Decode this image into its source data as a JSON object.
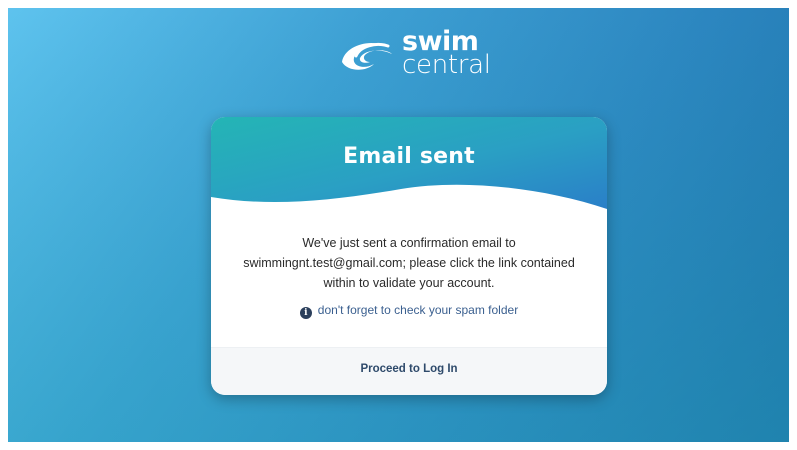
{
  "brand": {
    "name_line1": "swim",
    "name_line2": "central",
    "logo_icon": "swirl-icon"
  },
  "card": {
    "title": "Email sent",
    "message_lines": [
      "We've just sent a confirmation email to",
      "swimmingnt.test@gmail.com; please click the link contained",
      "within to validate your account."
    ],
    "hint_icon": "info-circle-icon",
    "hint_text": "don't forget to check your spam folder",
    "action_label": "Proceed to Log In"
  },
  "colors": {
    "background_start": "#5ec3ee",
    "background_end": "#1b6ea6",
    "header_teal": "#25b3b7",
    "header_blue": "#2a86c8",
    "link": "#3a5f8f",
    "action": "#2e4a6b"
  }
}
